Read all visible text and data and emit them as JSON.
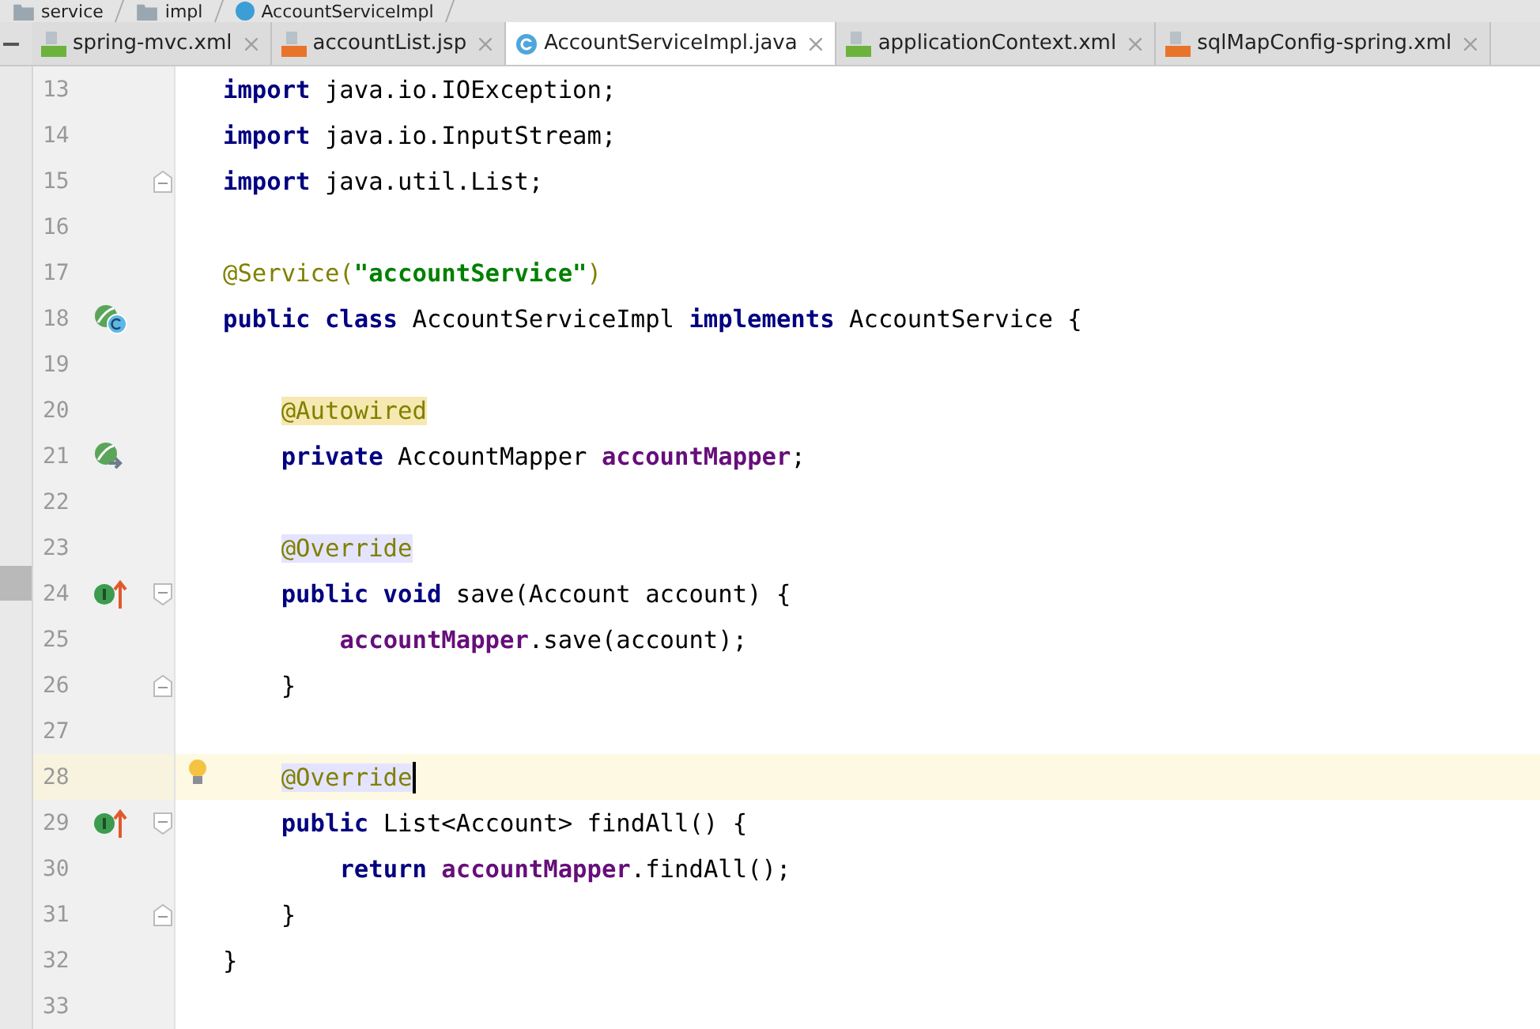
{
  "breadcrumb": [
    {
      "label": "service",
      "kind": "folder"
    },
    {
      "label": "impl",
      "kind": "folder"
    },
    {
      "label": "AccountServiceImpl",
      "kind": "class"
    }
  ],
  "tabs": [
    {
      "label": "spring-mvc.xml",
      "kind": "xml",
      "selected": false
    },
    {
      "label": "accountList.jsp",
      "kind": "jsp",
      "selected": false
    },
    {
      "label": "AccountServiceImpl.java",
      "kind": "class",
      "selected": true
    },
    {
      "label": "applicationContext.xml",
      "kind": "xml",
      "selected": false
    },
    {
      "label": "sqlMapConfig-spring.xml",
      "kind": "xml-orange",
      "selected": false
    }
  ],
  "lines": [
    {
      "number": "13",
      "kind": "plain",
      "tokens": [
        {
          "text": "import ",
          "kind": "keyword"
        },
        {
          "text": "java.io.IOException;",
          "kind": "plain"
        }
      ]
    },
    {
      "number": "14",
      "kind": "plain",
      "tokens": [
        {
          "text": "import ",
          "kind": "keyword"
        },
        {
          "text": "java.io.InputStream;",
          "kind": "plain"
        }
      ]
    },
    {
      "number": "15",
      "kind": "plain",
      "fold_end": true,
      "tokens": [
        {
          "text": "import ",
          "kind": "keyword"
        },
        {
          "text": "java.util.List;",
          "kind": "plain"
        }
      ]
    },
    {
      "number": "16",
      "kind": "plain"
    },
    {
      "number": "17",
      "kind": "plain",
      "tokens": [
        {
          "text": "@Service(",
          "kind": "annotation"
        },
        {
          "text": "\"accountService\"",
          "kind": "string"
        },
        {
          "text": ")",
          "kind": "annotation"
        }
      ]
    },
    {
      "number": "18",
      "kind": "bean-class",
      "tokens": [
        {
          "text": "public class ",
          "kind": "keyword"
        },
        {
          "text": "AccountServiceImpl ",
          "kind": "plain"
        },
        {
          "text": "implements ",
          "kind": "keyword"
        },
        {
          "text": "AccountService {",
          "kind": "plain"
        }
      ]
    },
    {
      "number": "19",
      "kind": "plain"
    },
    {
      "number": "20",
      "kind": "plain",
      "tokens": [
        {
          "text": "    @Autowired",
          "kind": "annotation-usage"
        }
      ]
    },
    {
      "number": "21",
      "kind": "bean-inject",
      "tokens": [
        {
          "text": "    private ",
          "kind": "keyword"
        },
        {
          "text": "AccountMapper ",
          "kind": "plain"
        },
        {
          "text": "accountMapper",
          "kind": "field"
        },
        {
          "text": ";",
          "kind": "plain"
        }
      ]
    },
    {
      "number": "22",
      "kind": "plain"
    },
    {
      "number": "23",
      "kind": "plain",
      "tokens": [
        {
          "text": "    @Override",
          "kind": "annotation-match"
        }
      ]
    },
    {
      "number": "24",
      "kind": "implements",
      "fold_start": true,
      "tokens": [
        {
          "text": "    public void ",
          "kind": "keyword"
        },
        {
          "text": "save(Account account) {",
          "kind": "plain"
        }
      ]
    },
    {
      "number": "25",
      "kind": "plain",
      "tokens": [
        {
          "text": "        accountMapper",
          "kind": "field"
        },
        {
          "text": ".save(account);",
          "kind": "plain"
        }
      ]
    },
    {
      "number": "26",
      "kind": "plain",
      "fold_end": true,
      "tokens": [
        {
          "text": "    }",
          "kind": "plain"
        }
      ]
    },
    {
      "number": "27",
      "kind": "plain"
    },
    {
      "number": "28",
      "kind": "plain",
      "current": true,
      "bulb": true,
      "caret": true,
      "tokens": [
        {
          "text": "    @Override",
          "kind": "annotation-match"
        }
      ]
    },
    {
      "number": "29",
      "kind": "implements",
      "fold_start": true,
      "tokens": [
        {
          "text": "    public ",
          "kind": "keyword"
        },
        {
          "text": "List<Account> findAll() {",
          "kind": "plain"
        }
      ]
    },
    {
      "number": "30",
      "kind": "plain",
      "tokens": [
        {
          "text": "        return ",
          "kind": "keyword"
        },
        {
          "text": "accountMapper",
          "kind": "field"
        },
        {
          "text": ".findAll();",
          "kind": "plain"
        }
      ]
    },
    {
      "number": "31",
      "kind": "plain",
      "fold_end": true,
      "tokens": [
        {
          "text": "    }",
          "kind": "plain"
        }
      ]
    },
    {
      "number": "32",
      "kind": "plain",
      "tokens": [
        {
          "text": "}",
          "kind": "plain"
        }
      ]
    },
    {
      "number": "33",
      "kind": "plain"
    }
  ]
}
